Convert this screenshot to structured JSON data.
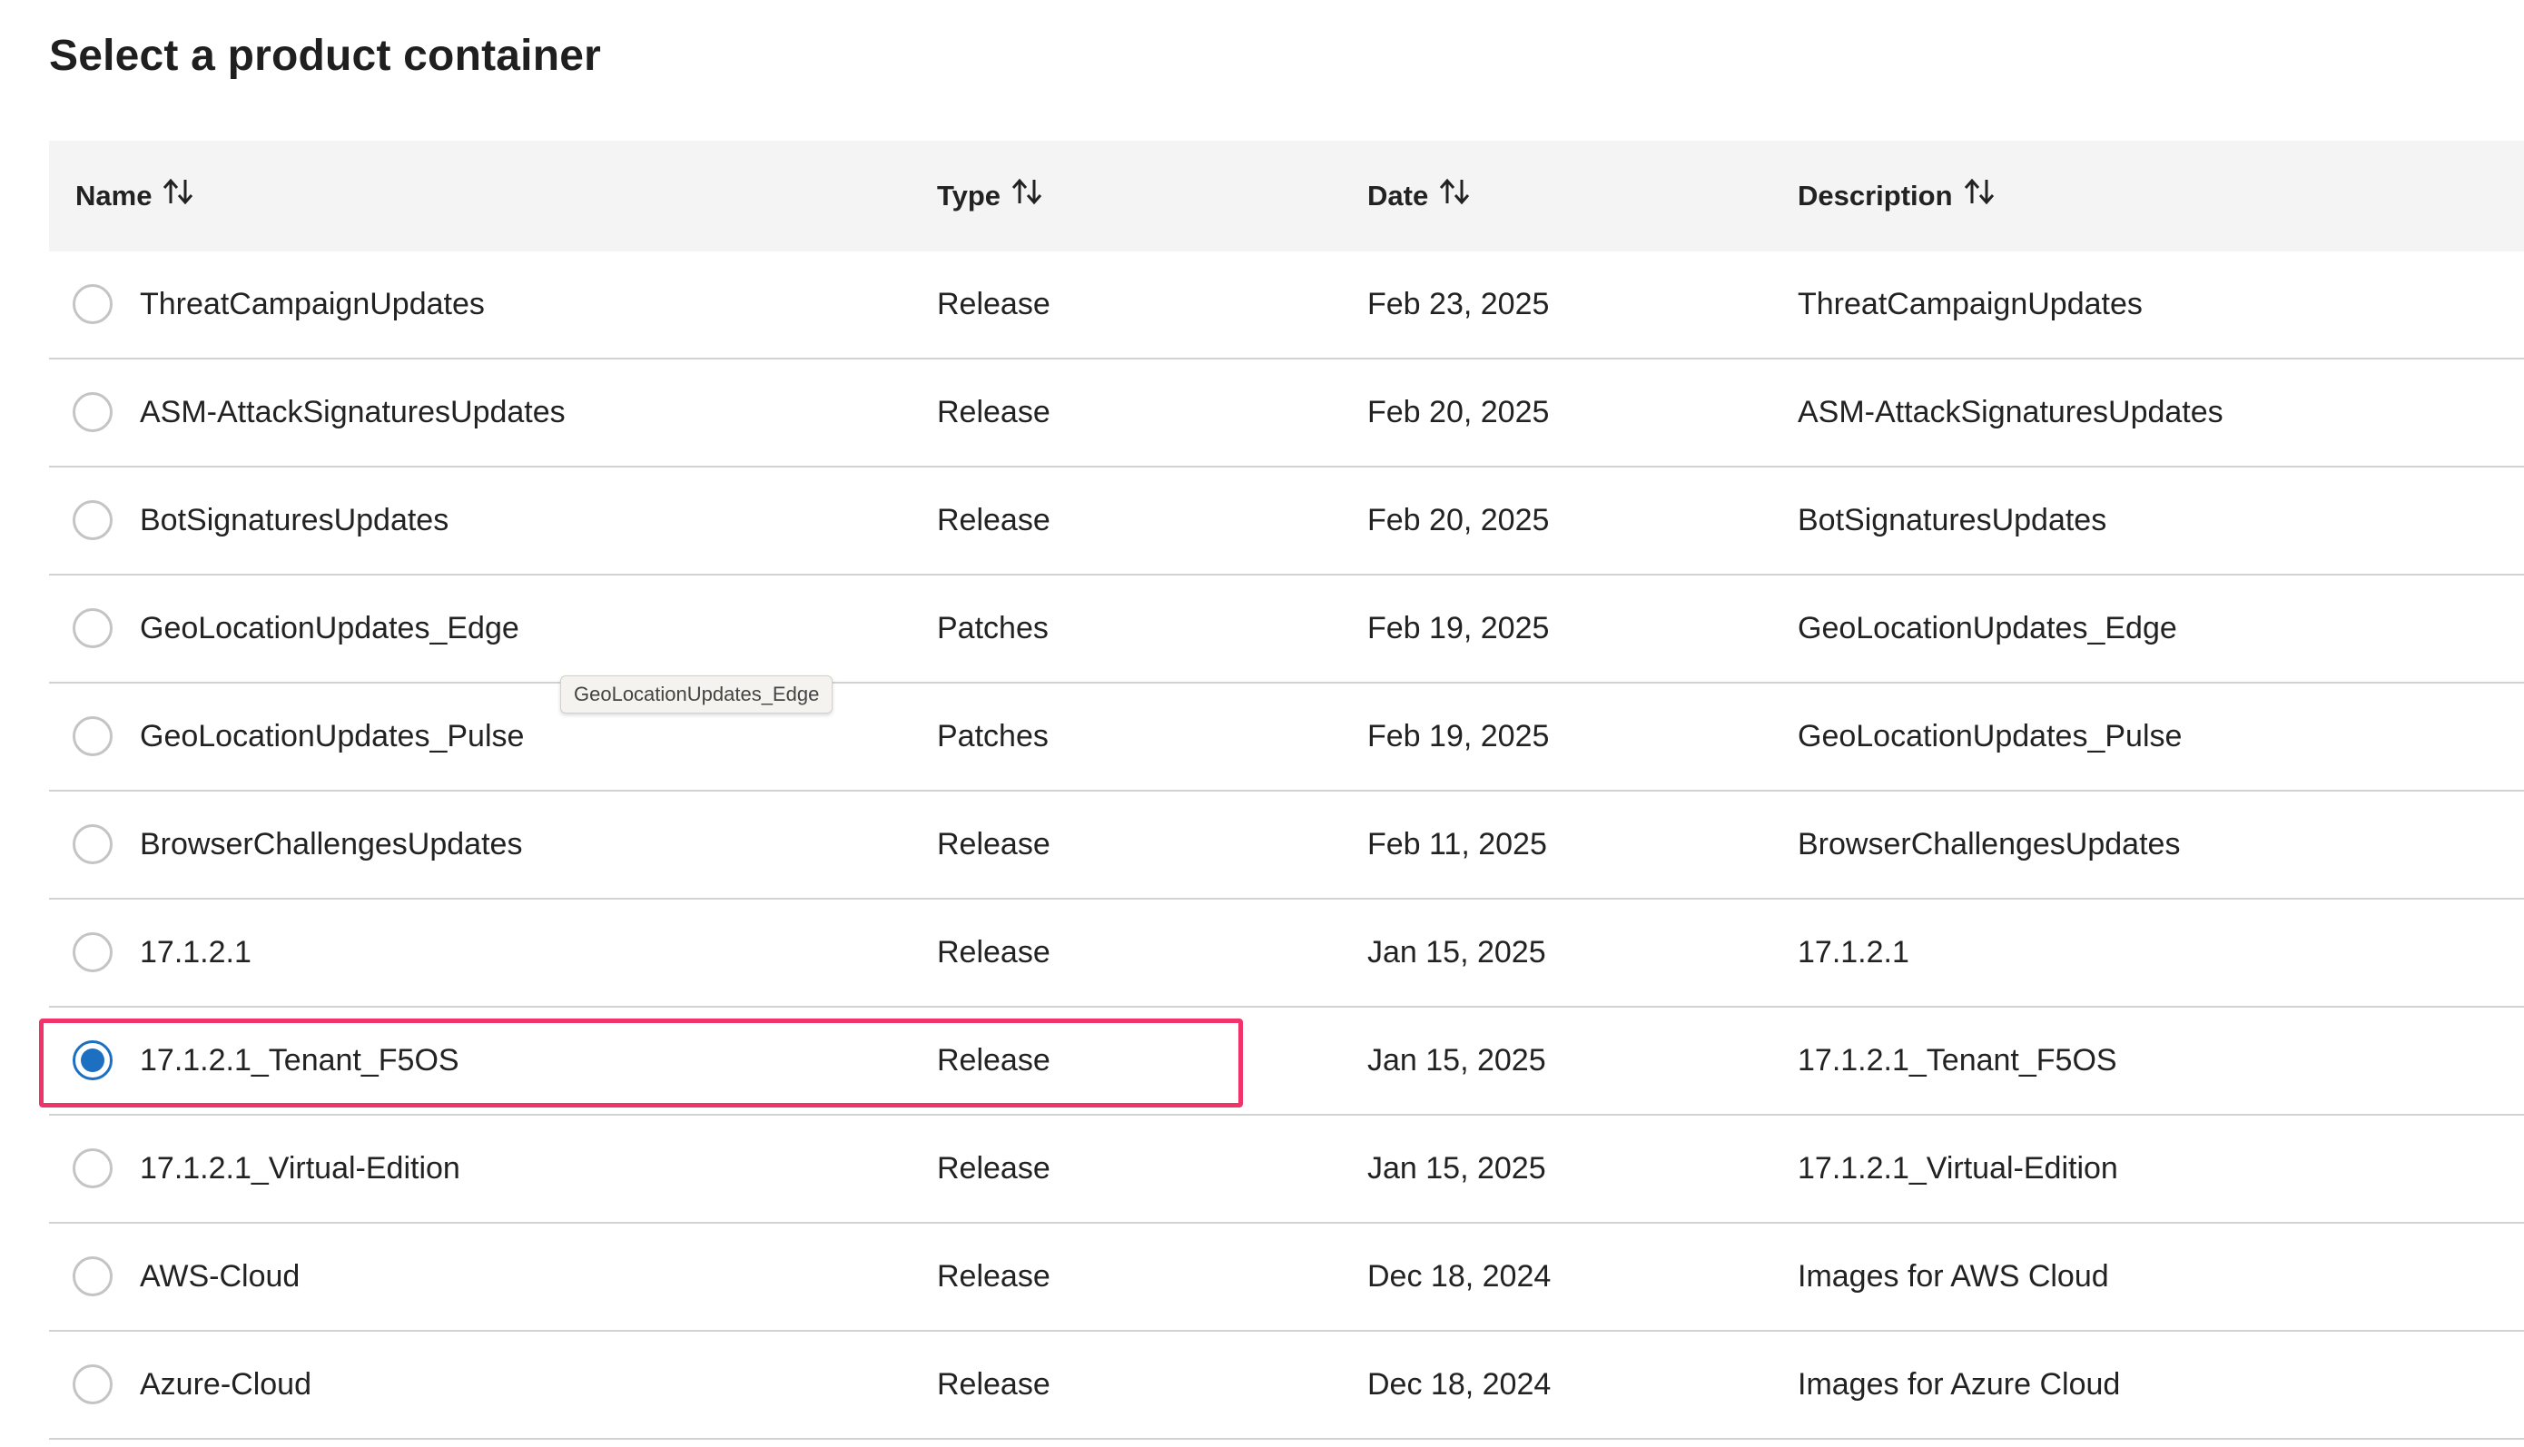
{
  "page": {
    "title": "Select a product container"
  },
  "table": {
    "columns": [
      {
        "key": "name",
        "label": "Name",
        "sort_icon": "sort-arrows-icon"
      },
      {
        "key": "type",
        "label": "Type",
        "sort_icon": "sort-arrows-icon"
      },
      {
        "key": "date",
        "label": "Date",
        "sort_icon": "sort-arrows-icon"
      },
      {
        "key": "description",
        "label": "Description",
        "sort_icon": "sort-arrows-icon"
      }
    ],
    "rows": [
      {
        "name": "ThreatCampaignUpdates",
        "type": "Release",
        "date": "Feb 23, 2025",
        "description": "ThreatCampaignUpdates",
        "selected": false
      },
      {
        "name": "ASM-AttackSignaturesUpdates",
        "type": "Release",
        "date": "Feb 20, 2025",
        "description": "ASM-AttackSignaturesUpdates",
        "selected": false
      },
      {
        "name": "BotSignaturesUpdates",
        "type": "Release",
        "date": "Feb 20, 2025",
        "description": "BotSignaturesUpdates",
        "selected": false
      },
      {
        "name": "GeoLocationUpdates_Edge",
        "type": "Patches",
        "date": "Feb 19, 2025",
        "description": "GeoLocationUpdates_Edge",
        "selected": false
      },
      {
        "name": "GeoLocationUpdates_Pulse",
        "type": "Patches",
        "date": "Feb 19, 2025",
        "description": "GeoLocationUpdates_Pulse",
        "selected": false
      },
      {
        "name": "BrowserChallengesUpdates",
        "type": "Release",
        "date": "Feb 11, 2025",
        "description": "BrowserChallengesUpdates",
        "selected": false
      },
      {
        "name": "17.1.2.1",
        "type": "Release",
        "date": "Jan 15, 2025",
        "description": "17.1.2.1",
        "selected": false
      },
      {
        "name": "17.1.2.1_Tenant_F5OS",
        "type": "Release",
        "date": "Jan 15, 2025",
        "description": "17.1.2.1_Tenant_F5OS",
        "selected": true
      },
      {
        "name": "17.1.2.1_Virtual-Edition",
        "type": "Release",
        "date": "Jan 15, 2025",
        "description": "17.1.2.1_Virtual-Edition",
        "selected": false
      },
      {
        "name": "AWS-Cloud",
        "type": "Release",
        "date": "Dec 18, 2024",
        "description": "Images for AWS Cloud",
        "selected": false
      },
      {
        "name": "Azure-Cloud",
        "type": "Release",
        "date": "Dec 18, 2024",
        "description": "Images for Azure Cloud",
        "selected": false
      }
    ]
  },
  "tooltip": {
    "text": "GeoLocationUpdates_Edge"
  },
  "colors": {
    "highlight_border": "#f0336b",
    "radio_selected": "#1c6fc1",
    "header_background": "#f4f4f4"
  }
}
